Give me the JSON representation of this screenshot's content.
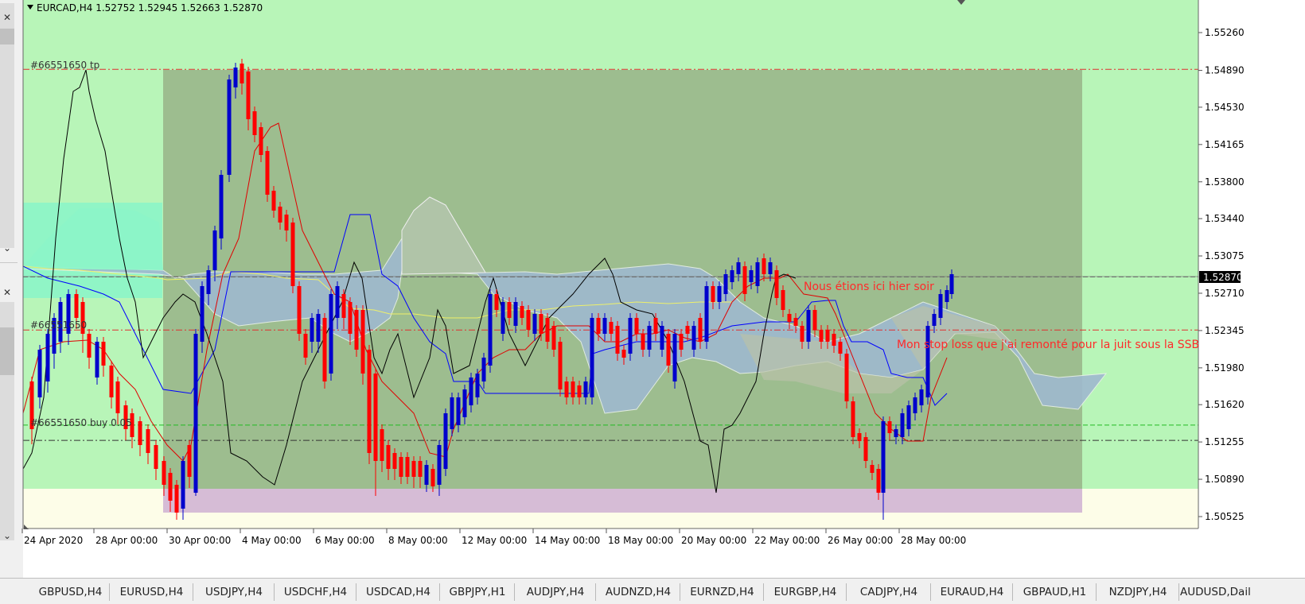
{
  "chart": {
    "symbol_header": "EURCAD,H4  1.52752 1.52945 1.52663 1.52870",
    "current_price": "1.52870",
    "price_min": 1.5035,
    "price_max": 1.556,
    "price_labels": [
      "1.55260",
      "1.54890",
      "1.54530",
      "1.54165",
      "1.53800",
      "1.53440",
      "1.53075",
      "1.52710",
      "1.52345",
      "1.51980",
      "1.51620",
      "1.51255",
      "1.50890",
      "1.50525"
    ],
    "date_labels": [
      "24 Apr 2020",
      "28 Apr 00:00",
      "30 Apr 00:00",
      "4 May 00:00",
      "6 May 00:00",
      "8 May 00:00",
      "12 May 00:00",
      "14 May 00:00",
      "18 May 00:00",
      "20 May 00:00",
      "22 May 00:00",
      "26 May 00:00",
      "28 May 00:00"
    ],
    "order_labels": {
      "tp": "#66551650 tp",
      "sl": "#66551650",
      "buy": "#66551650 buy 0.05"
    },
    "order_levels": {
      "tp": 1.549,
      "sl": 1.5235,
      "buy": 1.5127,
      "green": 1.5142
    },
    "annotations": [
      {
        "name": "annotation-yesterday",
        "text": "Nous étions ici hier soir",
        "color": "#ff2a2a"
      },
      {
        "name": "annotation-stoploss",
        "text": "Mon stop loss que j'ai remonté pour la juit sous la SSB",
        "color": "#ff2a2a"
      }
    ],
    "colors": {
      "background": "#b8f5b8",
      "zone_dark": "#9dbd8f",
      "zone_purple": "#d6bcd6",
      "bull_candle": "#0000cc",
      "bear_candle": "#ff0000",
      "kumo": "#9fb9cf",
      "kijun": "#0000ff",
      "tenkan": "#ff0000",
      "chikou": "#000000"
    }
  },
  "symbol_tabs": [
    "GBPUSD,H4",
    "EURUSD,H4",
    "USDJPY,H4",
    "USDCHF,H4",
    "USDCAD,H4",
    "GBPJPY,H1",
    "AUDJPY,H4",
    "AUDNZD,H4",
    "EURNZD,H4",
    "EURGBP,H4",
    "CADJPY,H4",
    "EURAUD,H4",
    "GBPAUD,H1",
    "NZDJPY,H4",
    "AUDUSD,Dail"
  ],
  "left_panel": {
    "close_glyph": "✕",
    "down_glyph": "⌄"
  }
}
